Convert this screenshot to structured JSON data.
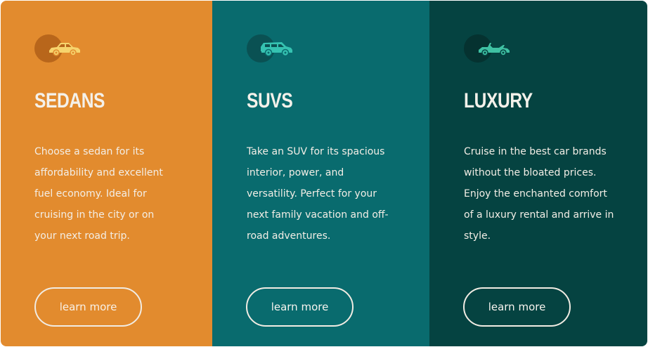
{
  "cards": [
    {
      "id": "sedans",
      "title": "SEDANS",
      "description": "Choose a sedan for its affordability and excellent fuel economy. Ideal for cruising in the city or on your next road trip.",
      "button_label": "learn more",
      "icon": "sedan-car-icon",
      "background": "#e28b2e",
      "icon_color": "#f6d46d"
    },
    {
      "id": "suvs",
      "title": "SUVS",
      "description": "Take an SUV for its spacious interior, power, and versatility. Perfect for your next family vacation and off-road adventures.",
      "button_label": "learn more",
      "icon": "suv-car-icon",
      "background": "#096b6e",
      "icon_color": "#35c2b1"
    },
    {
      "id": "luxury",
      "title": "LUXURY",
      "description": "Cruise in the best car brands without the bloated prices. Enjoy the enchanted comfort of a luxury rental and arrive in style.",
      "button_label": "learn more",
      "icon": "convertible-car-icon",
      "background": "#054341",
      "icon_color": "#3fc1a3"
    }
  ]
}
